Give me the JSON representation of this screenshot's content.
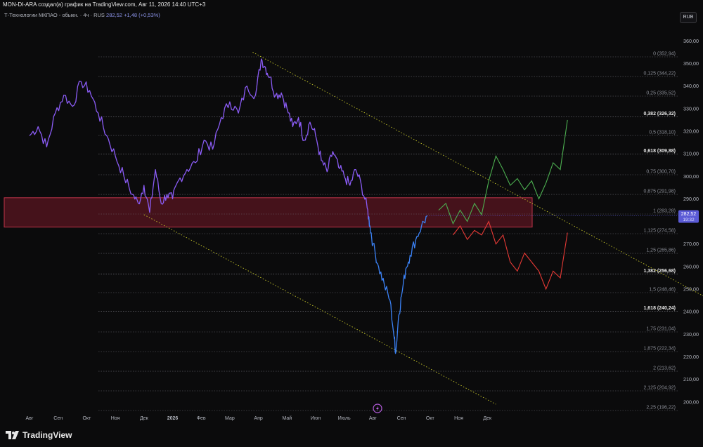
{
  "caption": "MON-DI-ARA создал(а) график на TradingView.com, Авг 11, 2026 14:40 UTC+3",
  "symbol": {
    "name": "Т-Технологии МКПАО - обыкн. · 4ч · RUS",
    "price": "282,52",
    "change": "+1,48 (+0,53%)"
  },
  "currency_button": "RUB",
  "brand": "TradingView",
  "colors": {
    "background": "#0b0b0c",
    "price_line_purple": "#8b5cf6",
    "price_line_blue": "#3b82f6",
    "zone_fill": "#5a1520",
    "zone_border": "#c0344a",
    "bull_projection": "#4caf50",
    "bear_projection": "#e53935",
    "channel": "#c7c72a",
    "price_tag": "#5b5bd6"
  },
  "icons": [
    "lightning-icon",
    "tradingview-logo-icon"
  ],
  "price_tag": {
    "value": "282,52",
    "countdown": "19:32"
  },
  "chart_data": {
    "type": "line",
    "x_ticks": [
      "Авг",
      "Сен",
      "Окт",
      "Ноя",
      "Дек",
      "2026",
      "Фев",
      "Мар",
      "Апр",
      "Май",
      "Июн",
      "Июль",
      "Авг",
      "Сен",
      "Окт",
      "Ноя",
      "Дек"
    ],
    "y_ticks": [
      "360,00",
      "350,00",
      "340,00",
      "330,00",
      "320,00",
      "310,00",
      "300,00",
      "290,00",
      "270,00",
      "260,00",
      "250,00",
      "240,00",
      "230,00",
      "220,00",
      "210,00",
      "200,00"
    ],
    "ylim": [
      196.22,
      365.0
    ],
    "grid": false,
    "fib_levels": [
      {
        "label": "0 (352,94)",
        "value": 352.94,
        "bold": false
      },
      {
        "label": "0,125 (344,22)",
        "value": 344.22,
        "bold": false
      },
      {
        "label": "0,25 (335,52)",
        "value": 335.52,
        "bold": false
      },
      {
        "label": "0,382 (326,32)",
        "value": 326.32,
        "bold": true
      },
      {
        "label": "0,5 (318,10)",
        "value": 318.1,
        "bold": false
      },
      {
        "label": "0,618 (309,88)",
        "value": 309.88,
        "bold": true
      },
      {
        "label": "0,75 (300,70)",
        "value": 300.7,
        "bold": false
      },
      {
        "label": "0,875 (291,98)",
        "value": 291.98,
        "bold": false
      },
      {
        "label": "1 (283,28)",
        "value": 283.28,
        "bold": false
      },
      {
        "label": "1,125 (274,58)",
        "value": 274.58,
        "bold": false
      },
      {
        "label": "1,25 (265,86)",
        "value": 265.86,
        "bold": false
      },
      {
        "label": "1,382 (256,68)",
        "value": 256.68,
        "bold": true
      },
      {
        "label": "1,5 (248,46)",
        "value": 248.46,
        "bold": false
      },
      {
        "label": "1,618 (240,24)",
        "value": 240.24,
        "bold": true
      },
      {
        "label": "1,75 (231,04)",
        "value": 231.04,
        "bold": false
      },
      {
        "label": "1,875 (222,34)",
        "value": 222.34,
        "bold": false
      },
      {
        "label": "2 (213,62)",
        "value": 213.62,
        "bold": false
      },
      {
        "label": "2,125 (204,92)",
        "value": 204.92,
        "bold": false
      },
      {
        "label": "2,25 (196,22)",
        "value": 196.22,
        "bold": false
      }
    ],
    "zone": {
      "from": 277.5,
      "to": 290.5
    },
    "price_series": [
      [
        0,
        318
      ],
      [
        0.3,
        322
      ],
      [
        0.6,
        313
      ],
      [
        0.9,
        328
      ],
      [
        1.2,
        336
      ],
      [
        1.5,
        331
      ],
      [
        1.8,
        342
      ],
      [
        2.1,
        338
      ],
      [
        2.4,
        328
      ],
      [
        2.7,
        318
      ],
      [
        3.0,
        309
      ],
      [
        3.3,
        300
      ],
      [
        3.6,
        292
      ],
      [
        3.8,
        288
      ],
      [
        4.0,
        296
      ],
      [
        4.2,
        284
      ],
      [
        4.4,
        303
      ],
      [
        4.6,
        288
      ],
      [
        4.8,
        292
      ],
      [
        5.0,
        290
      ],
      [
        5.2,
        298
      ],
      [
        5.5,
        303
      ],
      [
        5.8,
        306
      ],
      [
        6.1,
        316
      ],
      [
        6.4,
        312
      ],
      [
        6.7,
        326
      ],
      [
        7.0,
        333
      ],
      [
        7.3,
        328
      ],
      [
        7.6,
        340
      ],
      [
        7.9,
        336
      ],
      [
        8.1,
        352
      ],
      [
        8.25,
        348
      ],
      [
        8.4,
        344
      ],
      [
        8.6,
        336
      ],
      [
        8.8,
        337
      ],
      [
        9.0,
        330
      ],
      [
        9.2,
        322
      ],
      [
        9.4,
        326
      ],
      [
        9.6,
        316
      ],
      [
        9.8,
        324
      ],
      [
        10.0,
        318
      ],
      [
        10.2,
        307
      ],
      [
        10.4,
        302
      ],
      [
        10.6,
        311
      ],
      [
        10.8,
        304
      ],
      [
        11.0,
        300
      ],
      [
        11.2,
        296
      ],
      [
        11.4,
        303
      ],
      [
        11.6,
        296
      ],
      [
        11.8,
        286
      ],
      [
        11.9,
        278
      ],
      [
        12.0,
        270
      ],
      [
        12.2,
        260
      ],
      [
        12.4,
        252
      ],
      [
        12.6,
        245
      ],
      [
        12.75,
        228
      ],
      [
        12.8,
        222
      ],
      [
        12.9,
        238
      ],
      [
        13.0,
        247
      ],
      [
        13.15,
        259
      ],
      [
        13.3,
        265
      ],
      [
        13.5,
        272
      ],
      [
        13.7,
        278
      ],
      [
        13.9,
        282.5
      ]
    ],
    "blue_from_x": 11.9,
    "bull_projection": [
      [
        14.3,
        285
      ],
      [
        14.55,
        288
      ],
      [
        14.8,
        279
      ],
      [
        15.05,
        285
      ],
      [
        15.3,
        280
      ],
      [
        15.55,
        288
      ],
      [
        15.8,
        283
      ],
      [
        16.05,
        298
      ],
      [
        16.3,
        309
      ],
      [
        16.55,
        303
      ],
      [
        16.8,
        296
      ],
      [
        17.05,
        299
      ],
      [
        17.3,
        294
      ],
      [
        17.55,
        298
      ],
      [
        17.8,
        290
      ],
      [
        18.05,
        297
      ],
      [
        18.3,
        306
      ],
      [
        18.55,
        303
      ],
      [
        18.8,
        325
      ]
    ],
    "bear_projection": [
      [
        14.8,
        274
      ],
      [
        15.05,
        278
      ],
      [
        15.3,
        272
      ],
      [
        15.55,
        276
      ],
      [
        15.8,
        274
      ],
      [
        16.05,
        280
      ],
      [
        16.3,
        270
      ],
      [
        16.55,
        274
      ],
      [
        16.8,
        262
      ],
      [
        17.05,
        258
      ],
      [
        17.3,
        266
      ],
      [
        17.55,
        262
      ],
      [
        17.8,
        258
      ],
      [
        18.05,
        250
      ],
      [
        18.3,
        258
      ],
      [
        18.55,
        255
      ],
      [
        18.8,
        275
      ]
    ],
    "channel_upper": [
      [
        7.8,
        355
      ],
      [
        25.0,
        237
      ]
    ],
    "channel_lower": [
      [
        4.0,
        283
      ],
      [
        16.3,
        199
      ]
    ]
  }
}
